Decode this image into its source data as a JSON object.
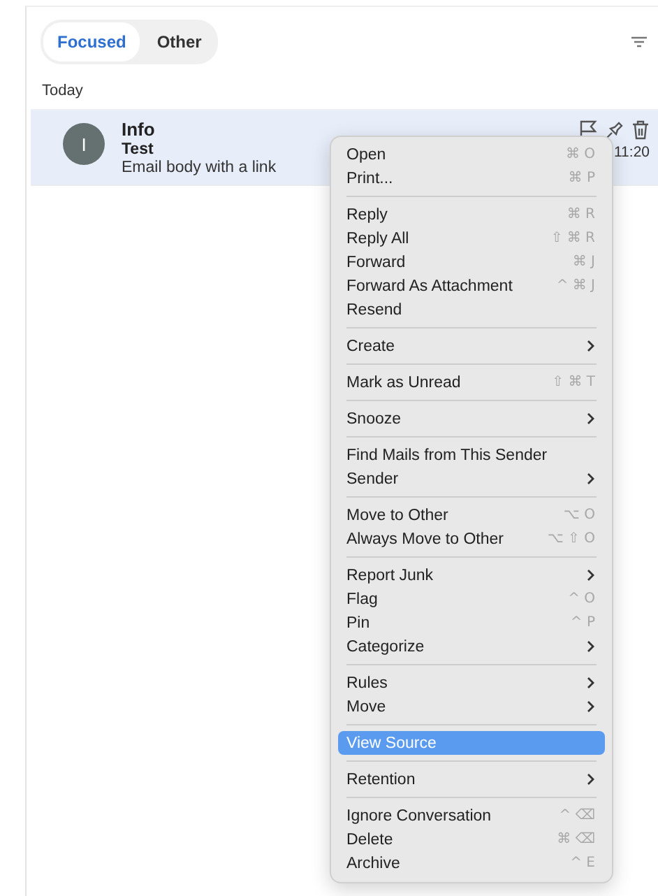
{
  "tabs": [
    {
      "label": "Focused",
      "selected": true
    },
    {
      "label": "Other",
      "selected": false
    }
  ],
  "section": "Today",
  "message": {
    "initial": "I",
    "sender": "Info",
    "subject": "Test",
    "preview": "Email body with a link",
    "time": "11:20",
    "selected": true
  },
  "context_menu": [
    [
      {
        "label": "Open",
        "shortcut": "⌘ O",
        "submenu": false,
        "selected": false
      },
      {
        "label": "Print...",
        "shortcut": "⌘ P",
        "submenu": false,
        "selected": false
      }
    ],
    [
      {
        "label": "Reply",
        "shortcut": "⌘ R",
        "submenu": false,
        "selected": false
      },
      {
        "label": "Reply All",
        "shortcut": "⇧ ⌘ R",
        "submenu": false,
        "selected": false
      },
      {
        "label": "Forward",
        "shortcut": "⌘ J",
        "submenu": false,
        "selected": false
      },
      {
        "label": "Forward As Attachment",
        "shortcut": "^ ⌘ J",
        "submenu": false,
        "selected": false
      },
      {
        "label": "Resend",
        "submenu": false,
        "selected": false
      }
    ],
    [
      {
        "label": "Create",
        "submenu": true,
        "selected": false
      }
    ],
    [
      {
        "label": "Mark as Unread",
        "shortcut": "⇧ ⌘ T",
        "submenu": false,
        "selected": false
      }
    ],
    [
      {
        "label": "Snooze",
        "submenu": true,
        "selected": false
      }
    ],
    [
      {
        "label": "Find Mails from This Sender",
        "submenu": false,
        "selected": false
      },
      {
        "label": "Sender",
        "submenu": true,
        "selected": false
      }
    ],
    [
      {
        "label": "Move to Other",
        "shortcut": "⌥ O",
        "submenu": false,
        "selected": false
      },
      {
        "label": "Always Move to Other",
        "shortcut": "⌥ ⇧ O",
        "submenu": false,
        "selected": false
      }
    ],
    [
      {
        "label": "Report Junk",
        "submenu": true,
        "selected": false
      },
      {
        "label": "Flag",
        "shortcut": "^ O",
        "submenu": false,
        "selected": false
      },
      {
        "label": "Pin",
        "shortcut": "^ P",
        "submenu": false,
        "selected": false
      },
      {
        "label": "Categorize",
        "submenu": true,
        "selected": false
      }
    ],
    [
      {
        "label": "Rules",
        "submenu": true,
        "selected": false
      },
      {
        "label": "Move",
        "submenu": true,
        "selected": false
      }
    ],
    [
      {
        "label": "View Source",
        "submenu": false,
        "selected": true
      }
    ],
    [
      {
        "label": "Retention",
        "submenu": true,
        "selected": false
      }
    ],
    [
      {
        "label": "Ignore Conversation",
        "shortcut": "^ ⌫",
        "submenu": false,
        "selected": false
      },
      {
        "label": "Delete",
        "shortcut": "⌘ ⌫",
        "submenu": false,
        "selected": false
      },
      {
        "label": "Archive",
        "shortcut": "^ E",
        "submenu": false,
        "selected": false
      }
    ]
  ]
}
